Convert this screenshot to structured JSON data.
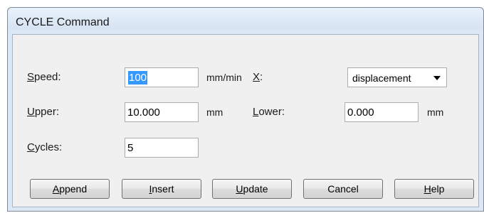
{
  "window": {
    "title": "CYCLE Command"
  },
  "fields": {
    "speed": {
      "label_underlined": "S",
      "label_rest": "peed:",
      "value": "100",
      "unit": "mm/min"
    },
    "x": {
      "label_underlined": "X",
      "label_rest": ":",
      "selected": "displacement"
    },
    "upper": {
      "label_underlined": "U",
      "label_rest": "pper:",
      "value": "10.000",
      "unit": "mm"
    },
    "lower": {
      "label_underlined": "L",
      "label_rest": "ower:",
      "value": "0.000",
      "unit": "mm"
    },
    "cycles": {
      "label_underlined": "C",
      "label_rest": "ycles:",
      "value": "5"
    }
  },
  "buttons": {
    "append": {
      "underlined": "A",
      "rest": "ppend"
    },
    "insert": {
      "underlined": "I",
      "rest": "nsert"
    },
    "update": {
      "underlined": "U",
      "rest": "pdate"
    },
    "cancel": {
      "label": "Cancel"
    },
    "help": {
      "underlined": "H",
      "rest": "elp"
    }
  },
  "colors": {
    "selection": "#3399ff",
    "dialog_bg": "#f0f0f0",
    "frame": "#dbe7f5"
  },
  "icons": {
    "dropdown": "chevron-down-icon"
  }
}
